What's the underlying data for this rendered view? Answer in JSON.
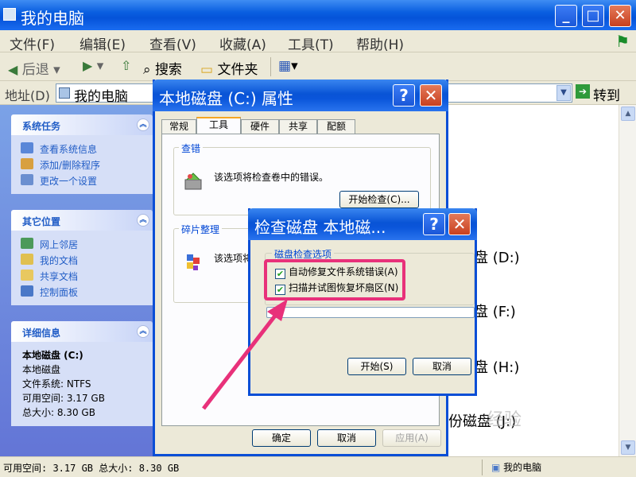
{
  "window": {
    "title": "我的电脑",
    "minimize": "_",
    "maximize": "□",
    "close": "✕"
  },
  "menu": [
    "文件(F)",
    "编辑(E)",
    "查看(V)",
    "收藏(A)",
    "工具(T)",
    "帮助(H)"
  ],
  "toolbar": {
    "back": "后退",
    "search": "搜索",
    "folders": "文件夹"
  },
  "address": {
    "label": "地址(D)",
    "value": "我的电脑",
    "go": "转到"
  },
  "left_pane": {
    "system_tasks": {
      "title": "系统任务",
      "items": [
        "查看系统信息",
        "添加/删除程序",
        "更改一个设置"
      ]
    },
    "other_places": {
      "title": "其它位置",
      "items": [
        "网上邻居",
        "我的文档",
        "共享文档",
        "控制面板"
      ]
    },
    "details": {
      "title": "详细信息",
      "name": "本地磁盘 (C:)",
      "type": "本地磁盘",
      "fs": "文件系统: NTFS",
      "free": "可用空间: 3.17 GB",
      "total": "总大小: 8.30 GB"
    }
  },
  "drives": [
    "盘 (D:)",
    "盘 (F:)",
    "盘 (H:)",
    "份磁盘 (J:)"
  ],
  "status": {
    "left": "可用空间: 3.17 GB 总大小: 8.30 GB",
    "right": "我的电脑"
  },
  "properties_dialog": {
    "title": "本地磁盘 (C:) 属性",
    "help": "?",
    "close": "✕",
    "tabs": [
      "常规",
      "工具",
      "硬件",
      "共享",
      "配额"
    ],
    "check_group": {
      "label": "查错",
      "text": "该选项将检查卷中的错误。",
      "button": "开始检查(C)..."
    },
    "defrag_group": {
      "label": "碎片整理",
      "text": "该选项将"
    },
    "ok": "确定",
    "cancel": "取消",
    "apply": "应用(A)"
  },
  "checkdisk_dialog": {
    "title": "检查磁盘 本地磁...",
    "help": "?",
    "close": "✕",
    "group_label": "磁盘检查选项",
    "options": [
      {
        "label": "自动修复文件系统错误(A)",
        "checked": true
      },
      {
        "label": "扫描并试图恢复坏扇区(N)",
        "checked": true
      }
    ],
    "start": "开始(S)",
    "cancel": "取消"
  },
  "watermark": "经验",
  "colors": {
    "titlebar": "#0a55da",
    "highlight": "#e8317a",
    "link": "#215dc6"
  }
}
